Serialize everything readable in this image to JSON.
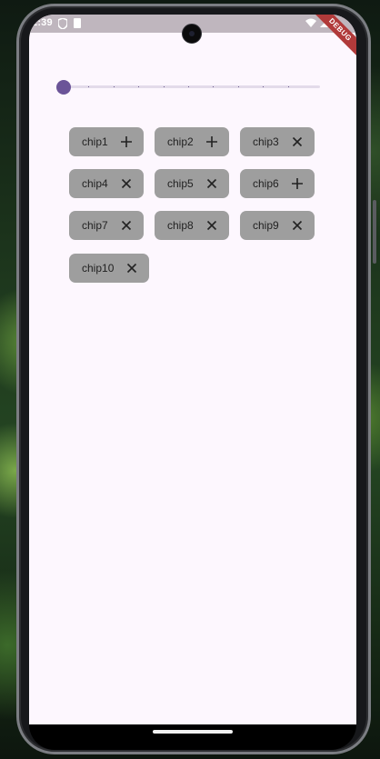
{
  "status_bar": {
    "time": "2:39"
  },
  "debug_banner": "DEBUG",
  "slider": {
    "value": 0,
    "divisions": 10
  },
  "chips": [
    {
      "label": "chip1",
      "icon": "plus-icon"
    },
    {
      "label": "chip2",
      "icon": "plus-icon"
    },
    {
      "label": "chip3",
      "icon": "close-icon"
    },
    {
      "label": "chip4",
      "icon": "close-icon"
    },
    {
      "label": "chip5",
      "icon": "close-icon"
    },
    {
      "label": "chip6",
      "icon": "plus-icon"
    },
    {
      "label": "chip7",
      "icon": "close-icon"
    },
    {
      "label": "chip8",
      "icon": "close-icon"
    },
    {
      "label": "chip9",
      "icon": "close-icon"
    },
    {
      "label": "chip10",
      "icon": "close-icon"
    }
  ],
  "colors": {
    "screen_background": "#fdf7fe",
    "chip_background": "#9e9e9e",
    "slider_accent": "#6b5498"
  }
}
